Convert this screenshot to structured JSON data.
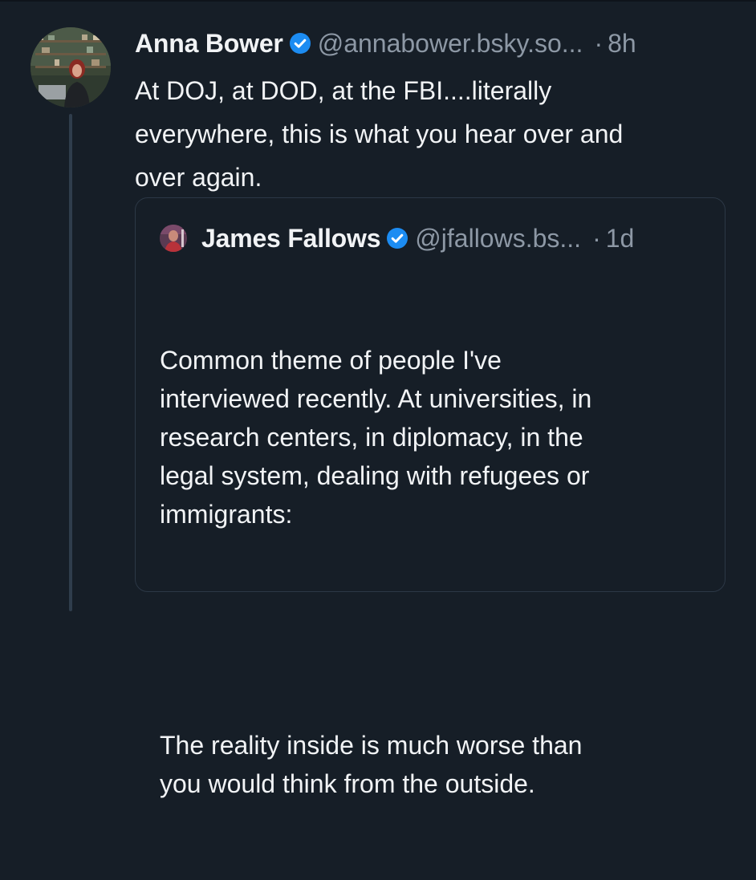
{
  "post": {
    "author_name": "Anna Bower",
    "handle": "@annabower.bsky.so...",
    "separator": "·",
    "time": "8h",
    "text": "At DOJ, at DOD, at the FBI....literally\neverywhere, this is what you hear over and\nover again."
  },
  "quote": {
    "author_name": "James Fallows",
    "handle": "@jfallows.bs...",
    "separator": "·",
    "time": "1d",
    "paragraph1": "Common theme of people I've\ninterviewed recently. At universities, in\nresearch centers, in diplomacy, in the\nlegal system, dealing with refugees or\nimmigrants:",
    "paragraph2": "The reality inside is much worse than\nyou would think from the outside."
  },
  "icons": {
    "verified": "verified-check-icon",
    "avatar_main": "avatar-photo",
    "avatar_quote": "avatar-photo"
  },
  "colors": {
    "background": "#161e27",
    "primary_text": "#f1f3f5",
    "secondary_text": "#8d98a5",
    "verified_blue": "#1c8cf2",
    "border": "#2c3846",
    "thread_line": "#2f3d4c"
  }
}
